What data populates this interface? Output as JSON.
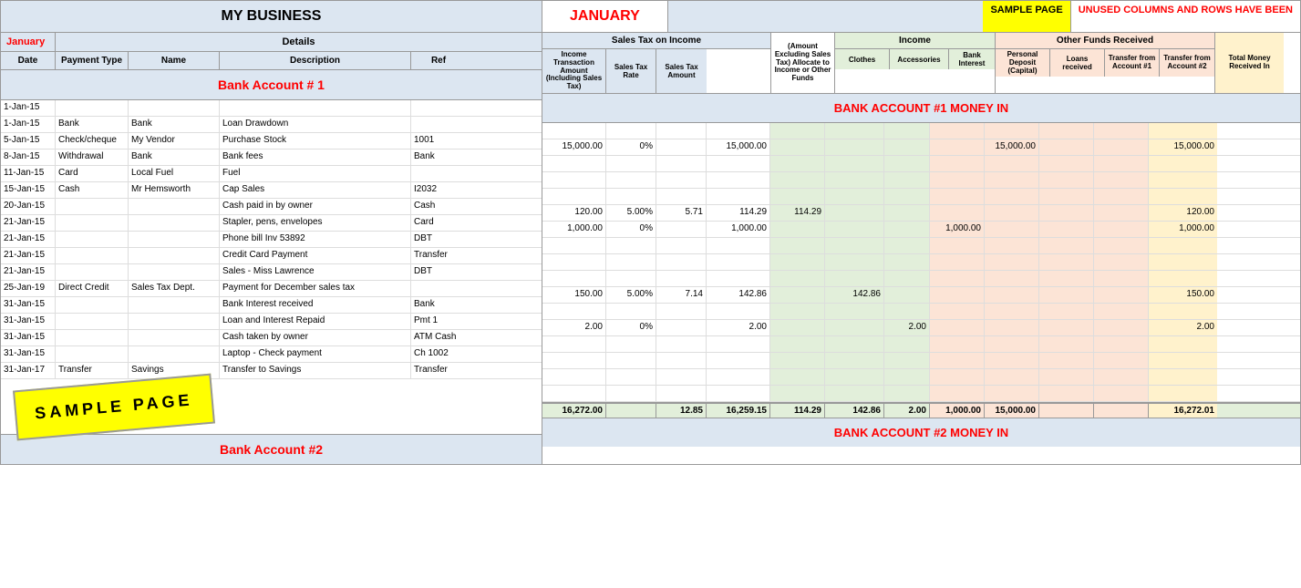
{
  "left": {
    "business_name": "MY BUSINESS",
    "jan_label": "January",
    "details_label": "Details",
    "col_headers": {
      "date": "Date",
      "payment_type": "Payment Type",
      "name": "Name",
      "description": "Description",
      "ref": "Ref"
    },
    "bank_account1": "Bank Account # 1",
    "bank_account2": "Bank Account #2",
    "sample_watermark": "SAMPLE PAGE",
    "rows": [
      {
        "date": "1-Jan-15",
        "paytype": "",
        "name": "",
        "desc": "",
        "ref": ""
      },
      {
        "date": "1-Jan-15",
        "paytype": "Bank",
        "name": "Bank",
        "desc": "Loan Drawdown",
        "ref": ""
      },
      {
        "date": "5-Jan-15",
        "paytype": "Check/cheque",
        "name": "My Vendor",
        "desc": "Purchase Stock",
        "ref": "1001"
      },
      {
        "date": "8-Jan-15",
        "paytype": "Withdrawal",
        "name": "Bank",
        "desc": "Bank fees",
        "ref": "Bank"
      },
      {
        "date": "11-Jan-15",
        "paytype": "Card",
        "name": "Local Fuel",
        "desc": "Fuel",
        "ref": ""
      },
      {
        "date": "15-Jan-15",
        "paytype": "Cash",
        "name": "Mr Hemsworth",
        "desc": "Cap Sales",
        "ref": "I2032"
      },
      {
        "date": "20-Jan-15",
        "paytype": "",
        "name": "",
        "desc": "Cash paid in by owner",
        "ref": "Cash"
      },
      {
        "date": "21-Jan-15",
        "paytype": "",
        "name": "",
        "desc": "Stapler, pens, envelopes",
        "ref": "Card"
      },
      {
        "date": "21-Jan-15",
        "paytype": "",
        "name": "",
        "desc": "Phone bill Inv 53892",
        "ref": "DBT"
      },
      {
        "date": "21-Jan-15",
        "paytype": "",
        "name": "",
        "desc": "Credit Card Payment",
        "ref": "Transfer"
      },
      {
        "date": "21-Jan-15",
        "paytype": "",
        "name": "",
        "desc": "Sales - Miss Lawrence",
        "ref": "DBT"
      },
      {
        "date": "25-Jan-19",
        "paytype": "Direct Credit",
        "name": "Sales Tax Dept.",
        "desc": "Payment for December sales tax",
        "ref": ""
      },
      {
        "date": "31-Jan-15",
        "paytype": "",
        "name": "",
        "desc": "Bank Interest received",
        "ref": "Bank"
      },
      {
        "date": "31-Jan-15",
        "paytype": "",
        "name": "",
        "desc": "Loan and Interest Repaid",
        "ref": "Pmt 1"
      },
      {
        "date": "31-Jan-15",
        "paytype": "",
        "name": "",
        "desc": "Cash taken by owner",
        "ref": "ATM Cash"
      },
      {
        "date": "31-Jan-15",
        "paytype": "",
        "name": "",
        "desc": "Laptop - Check payment",
        "ref": "Ch 1002"
      },
      {
        "date": "31-Jan-17",
        "paytype": "Transfer",
        "name": "Savings",
        "desc": "Transfer to Savings",
        "ref": "Transfer"
      }
    ]
  },
  "right": {
    "january_title": "JANUARY",
    "sample_page": "SAMPLE PAGE",
    "unused_cols": "UNUSED COLUMNS AND ROWS HAVE BEEN",
    "bank_acct1_money_in": "BANK ACCOUNT #1 MONEY IN",
    "bank_acct2_money_in": "BANK ACCOUNT #2 MONEY IN",
    "sales_tax_header": "Sales Tax on Income",
    "income_header": "Income",
    "other_funds_header": "Other Funds Received",
    "col_headers": {
      "income_transaction": "Income Transaction Amount (Including Sales Tax)",
      "sales_tax_rate": "Sales Tax Rate",
      "sales_tax_amount": "Sales Tax Amount",
      "allocate_to": "(Amount Excluding Sales Tax) Allocate to Income or Other Funds",
      "clothes": "Clothes",
      "accessories": "Accessories",
      "bank_interest": "Bank Interest",
      "personal_deposit": "Personal Deposit (Capital)",
      "loans_received": "Loans received",
      "transfer_from_acct1": "Transfer from Account #1",
      "transfer_from_acct2": "Transfer from Account #2",
      "total_money_received": "Total Money Received In"
    },
    "col_widths": {
      "income_trans": 70,
      "tax_rate": 55,
      "tax_amount": 55,
      "allocate": 70,
      "clothes": 60,
      "accessories": 65,
      "bank_interest": 50,
      "personal_deposit": 60,
      "loans_received": 60,
      "transfer1": 60,
      "transfer2": 60,
      "total": 75
    },
    "data_rows": [
      {
        "income": "",
        "rate": "",
        "tax": "",
        "alloc": "",
        "clothes": "",
        "access": "",
        "interest": "",
        "deposit": "",
        "loans": "",
        "trans1": "",
        "trans2": "",
        "total": ""
      },
      {
        "income": "15,000.00",
        "rate": "0%",
        "tax": "",
        "alloc": "15,000.00",
        "clothes": "",
        "access": "",
        "interest": "",
        "deposit": "",
        "loans": "15,000.00",
        "trans1": "",
        "trans2": "",
        "total": "15,000.00"
      },
      {
        "income": "",
        "rate": "",
        "tax": "",
        "alloc": "",
        "clothes": "",
        "access": "",
        "interest": "",
        "deposit": "",
        "loans": "",
        "trans1": "",
        "trans2": "",
        "total": ""
      },
      {
        "income": "",
        "rate": "",
        "tax": "",
        "alloc": "",
        "clothes": "",
        "access": "",
        "interest": "",
        "deposit": "",
        "loans": "",
        "trans1": "",
        "trans2": "",
        "total": ""
      },
      {
        "income": "",
        "rate": "",
        "tax": "",
        "alloc": "",
        "clothes": "",
        "access": "",
        "interest": "",
        "deposit": "",
        "loans": "",
        "trans1": "",
        "trans2": "",
        "total": ""
      },
      {
        "income": "120.00",
        "rate": "5.00%",
        "tax": "5.71",
        "alloc": "114.29",
        "clothes": "114.29",
        "access": "",
        "interest": "",
        "deposit": "",
        "loans": "",
        "trans1": "",
        "trans2": "",
        "total": "120.00"
      },
      {
        "income": "1,000.00",
        "rate": "0%",
        "tax": "",
        "alloc": "1,000.00",
        "clothes": "",
        "access": "",
        "interest": "",
        "deposit": "1,000.00",
        "loans": "",
        "trans1": "",
        "trans2": "",
        "total": "1,000.00"
      },
      {
        "income": "",
        "rate": "",
        "tax": "",
        "alloc": "",
        "clothes": "",
        "access": "",
        "interest": "",
        "deposit": "",
        "loans": "",
        "trans1": "",
        "trans2": "",
        "total": ""
      },
      {
        "income": "",
        "rate": "",
        "tax": "",
        "alloc": "",
        "clothes": "",
        "access": "",
        "interest": "",
        "deposit": "",
        "loans": "",
        "trans1": "",
        "trans2": "",
        "total": ""
      },
      {
        "income": "",
        "rate": "",
        "tax": "",
        "alloc": "",
        "clothes": "",
        "access": "",
        "interest": "",
        "deposit": "",
        "loans": "",
        "trans1": "",
        "trans2": "",
        "total": ""
      },
      {
        "income": "150.00",
        "rate": "5.00%",
        "tax": "7.14",
        "alloc": "142.86",
        "clothes": "",
        "access": "142.86",
        "interest": "",
        "deposit": "",
        "loans": "",
        "trans1": "",
        "trans2": "",
        "total": "150.00"
      },
      {
        "income": "",
        "rate": "",
        "tax": "",
        "alloc": "",
        "clothes": "",
        "access": "",
        "interest": "",
        "deposit": "",
        "loans": "",
        "trans1": "",
        "trans2": "",
        "total": ""
      },
      {
        "income": "2.00",
        "rate": "0%",
        "tax": "",
        "alloc": "2.00",
        "clothes": "",
        "access": "",
        "interest": "2.00",
        "deposit": "",
        "loans": "",
        "trans1": "",
        "trans2": "",
        "total": "2.00"
      },
      {
        "income": "",
        "rate": "",
        "tax": "",
        "alloc": "",
        "clothes": "",
        "access": "",
        "interest": "",
        "deposit": "",
        "loans": "",
        "trans1": "",
        "trans2": "",
        "total": ""
      },
      {
        "income": "",
        "rate": "",
        "tax": "",
        "alloc": "",
        "clothes": "",
        "access": "",
        "interest": "",
        "deposit": "",
        "loans": "",
        "trans1": "",
        "trans2": "",
        "total": ""
      },
      {
        "income": "",
        "rate": "",
        "tax": "",
        "alloc": "",
        "clothes": "",
        "access": "",
        "interest": "",
        "deposit": "",
        "loans": "",
        "trans1": "",
        "trans2": "",
        "total": ""
      },
      {
        "income": "",
        "rate": "",
        "tax": "",
        "alloc": "",
        "clothes": "",
        "access": "",
        "interest": "",
        "deposit": "",
        "loans": "",
        "trans1": "",
        "trans2": "",
        "total": ""
      }
    ],
    "totals": {
      "income": "16,272.00",
      "rate": "",
      "tax": "12.85",
      "alloc": "16,259.15",
      "clothes": "114.29",
      "accessories": "142.86",
      "interest": "2.00",
      "deposit": "1,000.00",
      "loans": "15,000.00",
      "trans1": "",
      "trans2": "",
      "total": "16,272.01"
    }
  }
}
